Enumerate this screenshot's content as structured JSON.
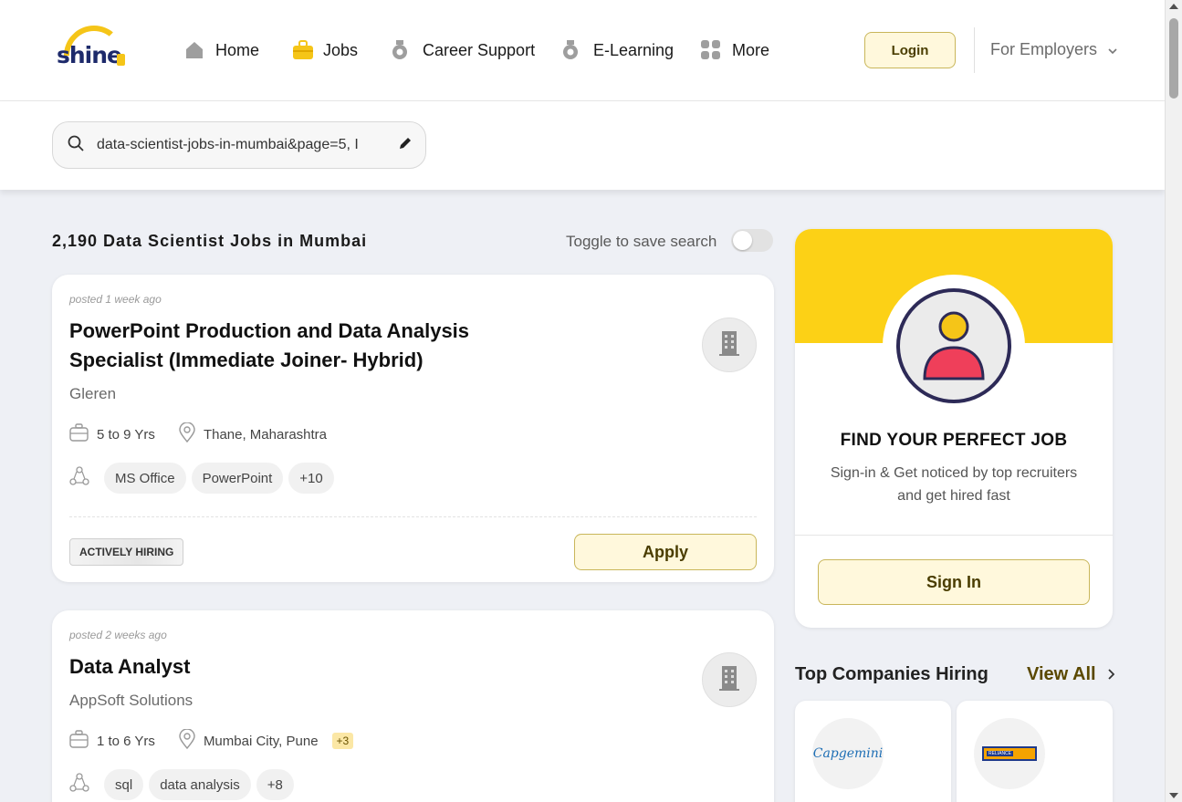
{
  "brand": {
    "logo_text": "shine",
    "logo_sub": ".com"
  },
  "nav": {
    "items": [
      {
        "label": "Home",
        "icon": "home-icon"
      },
      {
        "label": "Jobs",
        "icon": "briefcase-icon"
      },
      {
        "label": "Career Support",
        "icon": "career-support-icon"
      },
      {
        "label": "E-Learning",
        "icon": "elearning-icon"
      },
      {
        "label": "More",
        "icon": "grid-icon"
      }
    ],
    "login_label": "Login",
    "employers_label": "For Employers"
  },
  "search": {
    "query": "data-scientist-jobs-in-mumbai&page=5, I"
  },
  "results": {
    "title": "2,190 Data Scientist Jobs in Mumbai",
    "toggle_label": "Toggle to save search",
    "toggle_on": false
  },
  "jobs": [
    {
      "posted": "posted 1 week ago",
      "title_line1": "PowerPoint Production and Data Analysis",
      "title_line2": "Specialist (Immediate Joiner- Hybrid)",
      "company": "Gleren",
      "experience": "5 to 9 Yrs",
      "location": "Thane, Maharashtra",
      "skills": [
        "MS Office",
        "PowerPoint",
        "+10"
      ],
      "badge": "ACTIVELY HIRING",
      "apply_label": "Apply"
    },
    {
      "posted": "posted 2 weeks ago",
      "title_line1": "Data Analyst",
      "company": "AppSoft Solutions",
      "experience": "1 to 6 Yrs",
      "location": "Mumbai City, Pune",
      "location_more": "+3",
      "skills": [
        "sql",
        "data analysis",
        "+8"
      ]
    }
  ],
  "promo": {
    "heading": "FIND YOUR PERFECT JOB",
    "sub_line1": "Sign-in & Get noticed by top recruiters",
    "sub_line2": "and get hired fast",
    "signin_label": "Sign In"
  },
  "top_companies": {
    "title": "Top Companies Hiring",
    "view_all": "View All",
    "companies": [
      {
        "name": "Capgemini"
      },
      {
        "name": "RELIANCE"
      }
    ]
  },
  "colors": {
    "accent": "#fcd116",
    "button_bg": "#fff8dc",
    "button_border": "#c9b65a",
    "brand_blue": "#1d2a6b"
  }
}
